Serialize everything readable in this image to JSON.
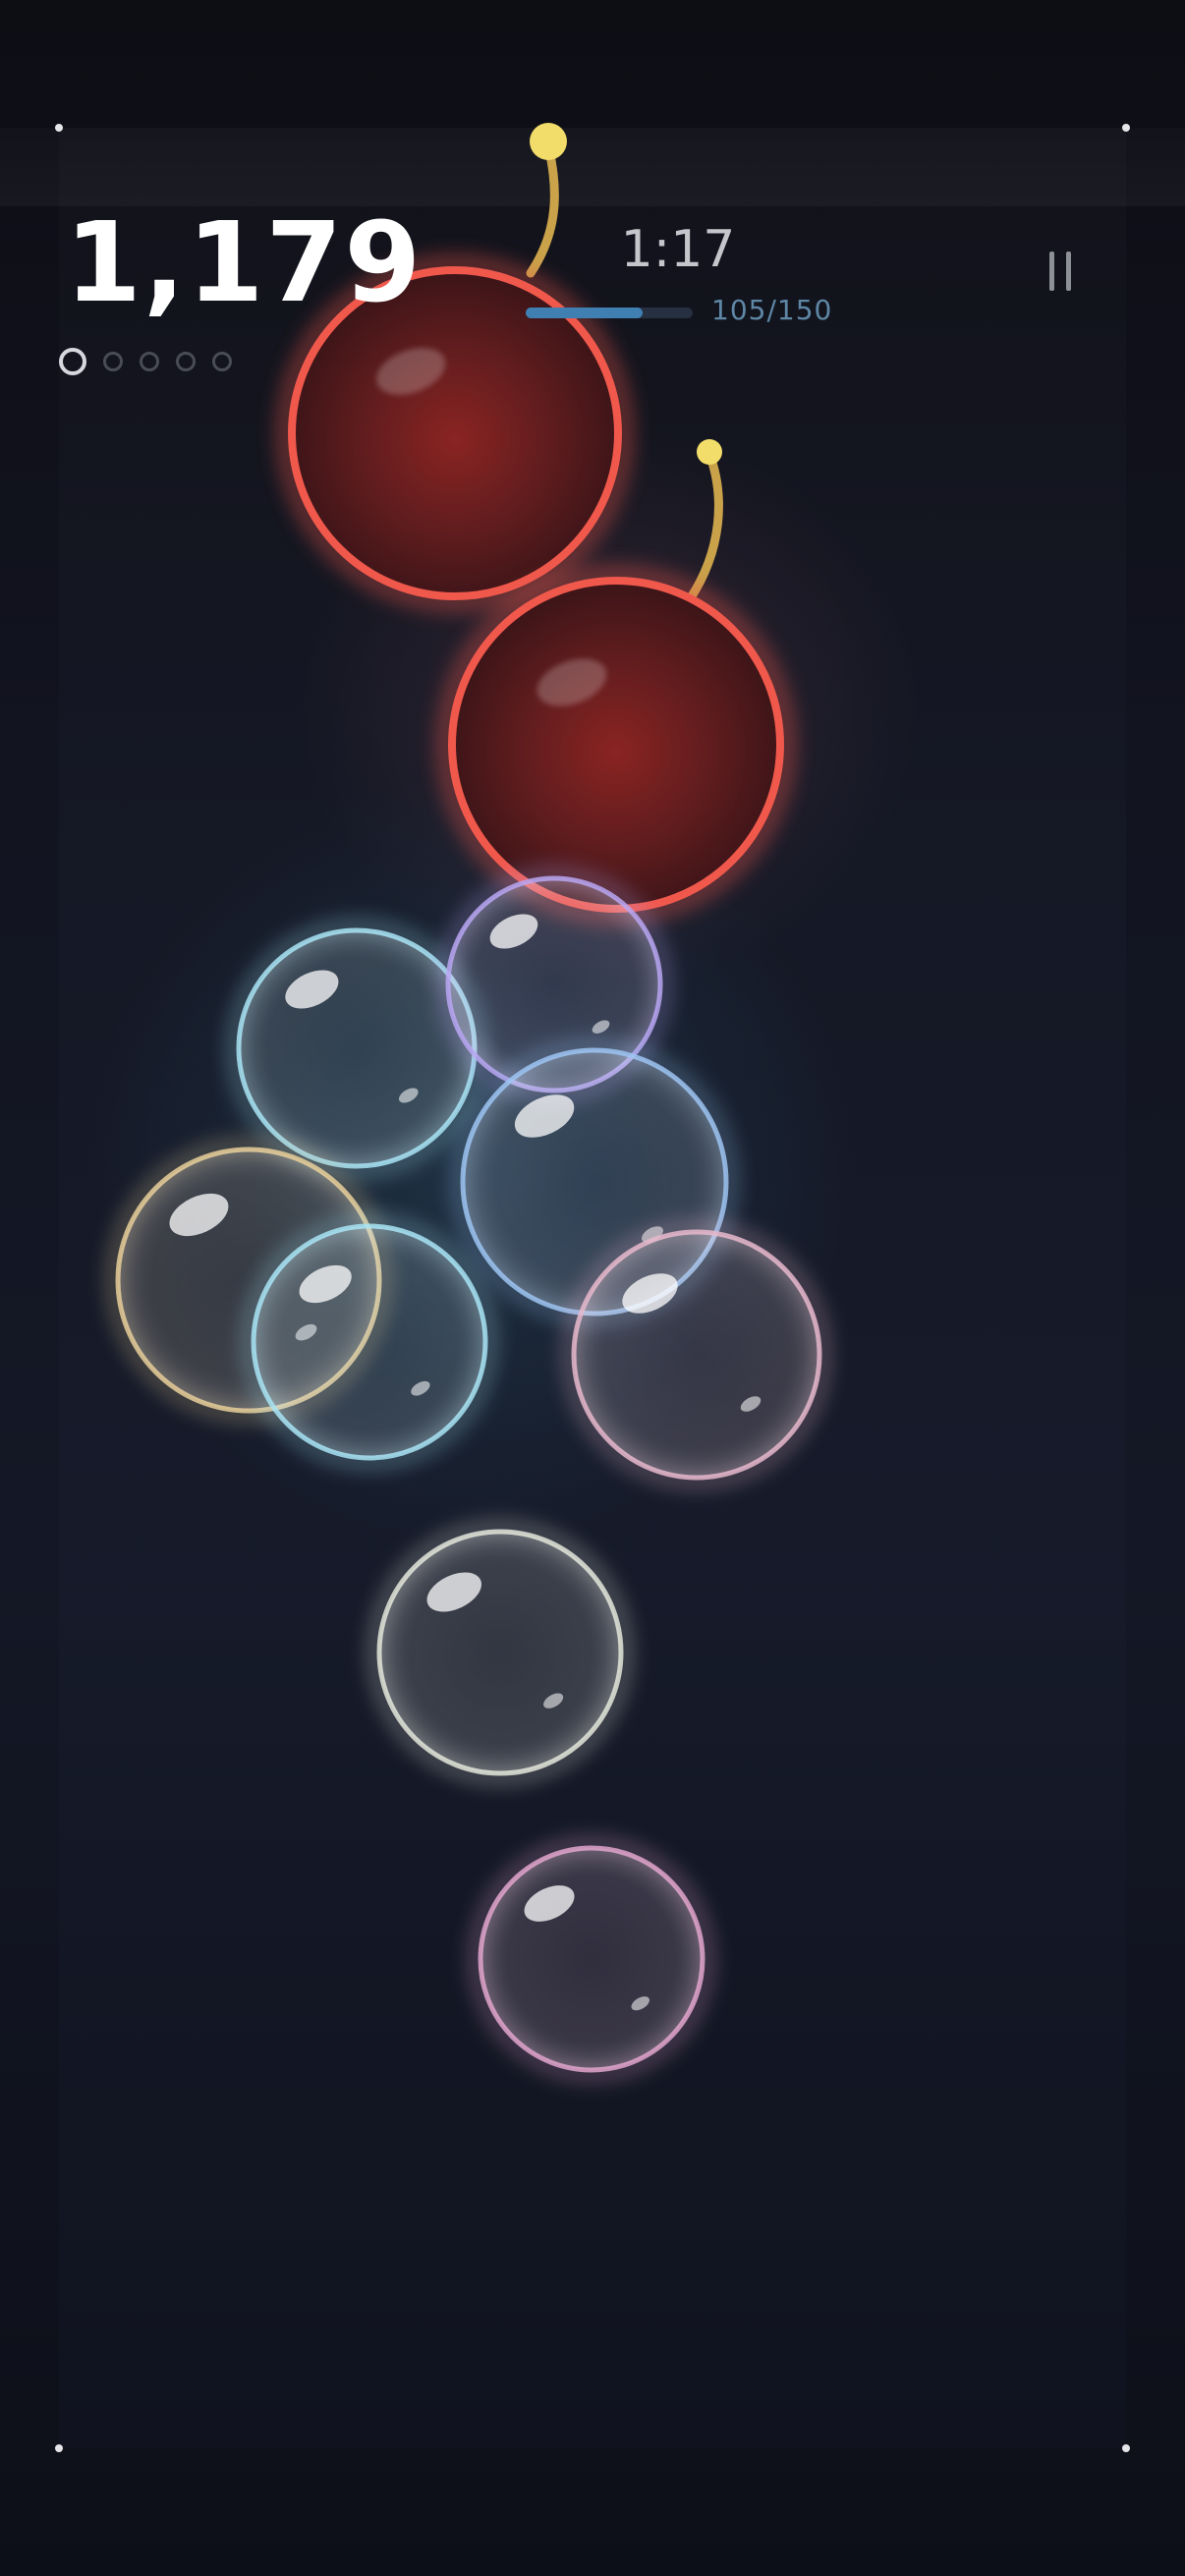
{
  "hud": {
    "score": "1,179",
    "timer": "1:17",
    "progress": {
      "current": 105,
      "total": 150,
      "label": "105/150"
    },
    "combo_dots": {
      "total": 5,
      "active": 1
    }
  },
  "colors": {
    "cherry": "#f0584c",
    "stem": "#c9a24a",
    "stem_tip": "#f2dc6a",
    "bubble_cyan": "#a8e4f4",
    "bubble_lavender": "#b8a6f2",
    "bubble_blue": "#9cc4f2",
    "bubble_gold": "#e8cf9a",
    "bubble_pink": "#e8b8cc",
    "bubble_white": "#e4e6da",
    "bubble_magenta": "#e2a4cc"
  },
  "bubbles": [
    {
      "type": "cherry",
      "color": "cherry"
    },
    {
      "type": "cherry",
      "color": "cherry"
    },
    {
      "type": "bubble",
      "color": "bubble_cyan"
    },
    {
      "type": "bubble",
      "color": "bubble_lavender"
    },
    {
      "type": "bubble",
      "color": "bubble_blue"
    },
    {
      "type": "bubble",
      "color": "bubble_gold"
    },
    {
      "type": "bubble",
      "color": "bubble_cyan"
    },
    {
      "type": "bubble",
      "color": "bubble_pink"
    },
    {
      "type": "bubble",
      "color": "bubble_white"
    },
    {
      "type": "bubble",
      "color": "bubble_magenta"
    }
  ]
}
